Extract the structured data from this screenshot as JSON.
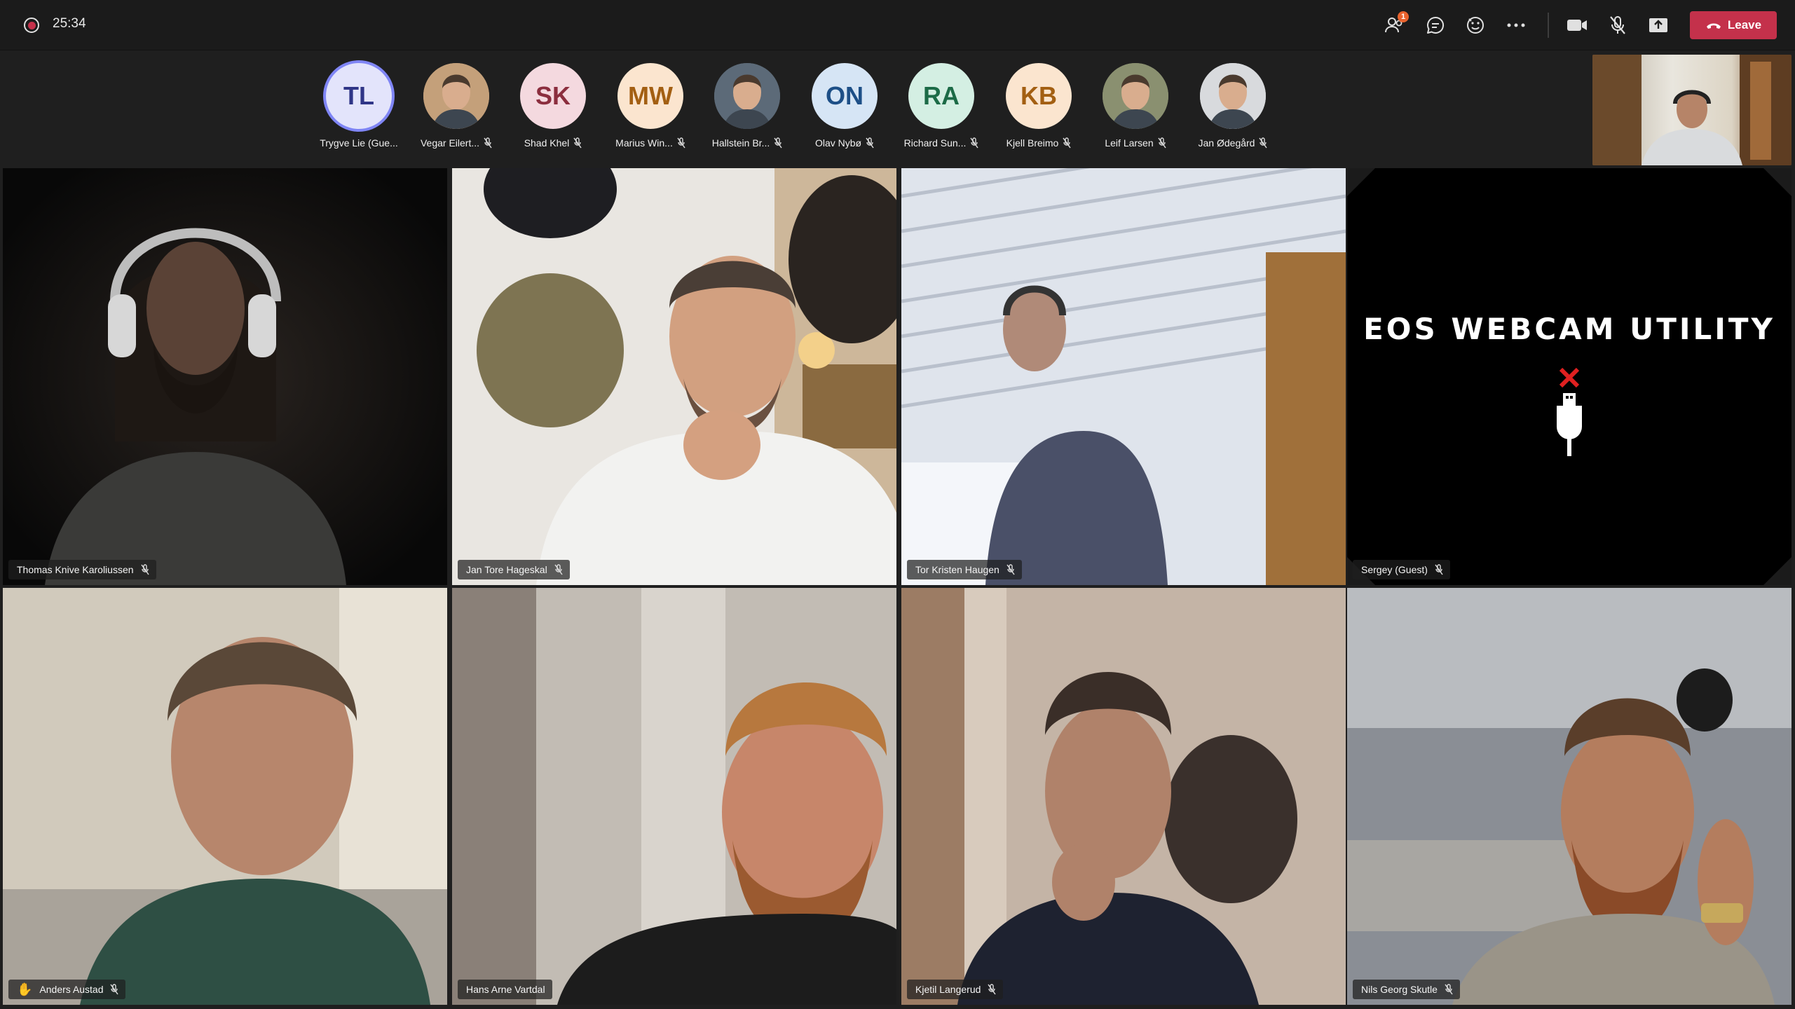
{
  "meeting": {
    "timer": "25:34",
    "participants_badge": "1",
    "leave_label": "Leave"
  },
  "icons": {
    "record": "recording-indicator-icon",
    "people": "people-icon",
    "chat": "chat-icon",
    "reactions": "reactions-icon",
    "more": "more-actions-icon",
    "camera": "camera-icon",
    "mic": "mic-muted-icon",
    "share": "share-screen-icon",
    "hangup": "hang-up-icon"
  },
  "participants": [
    {
      "initials": "TL",
      "name": "Trygve Lie (Gue...",
      "bg": "#e3e4fb",
      "fg": "#2f3587",
      "muted": false,
      "photo": false
    },
    {
      "initials": "",
      "name": "Vegar Eilert...",
      "bg": "#c4a07a",
      "fg": "#ffffff",
      "muted": true,
      "photo": true
    },
    {
      "initials": "SK",
      "name": "Shad Khel",
      "bg": "#f4d9df",
      "fg": "#8b2e3e",
      "muted": true,
      "photo": false
    },
    {
      "initials": "MW",
      "name": "Marius Win...",
      "bg": "#fbe5cf",
      "fg": "#a35f12",
      "muted": true,
      "photo": false
    },
    {
      "initials": "",
      "name": "Hallstein Br...",
      "bg": "#5c6a78",
      "fg": "#ffffff",
      "muted": true,
      "photo": true
    },
    {
      "initials": "ON",
      "name": "Olav Nybø",
      "bg": "#d6e5f5",
      "fg": "#1d4f87",
      "muted": true,
      "photo": false
    },
    {
      "initials": "RA",
      "name": "Richard Sun...",
      "bg": "#d4efe3",
      "fg": "#1c6b47",
      "muted": true,
      "photo": false
    },
    {
      "initials": "KB",
      "name": "Kjell Breimo",
      "bg": "#fbe5cf",
      "fg": "#a35f12",
      "muted": true,
      "photo": false
    },
    {
      "initials": "",
      "name": "Leif Larsen",
      "bg": "#8a9070",
      "fg": "#ffffff",
      "muted": true,
      "photo": true
    },
    {
      "initials": "",
      "name": "Jan Ødegård",
      "bg": "#d8dadd",
      "fg": "#ffffff",
      "muted": true,
      "photo": true
    }
  ],
  "tiles": [
    {
      "name": "Thomas Knive Karoliussen",
      "raised_hand": false
    },
    {
      "name": "Jan Tore Hageskal",
      "raised_hand": false
    },
    {
      "name": "Tor Kristen Haugen",
      "raised_hand": false
    },
    {
      "name": "Sergey (Guest)",
      "raised_hand": false,
      "placeholder_title": "EOS WEBCAM UTILITY"
    },
    {
      "name": "Anders Austad",
      "raised_hand": true
    },
    {
      "name": "Hans Arne Vartdal",
      "raised_hand": false
    },
    {
      "name": "Kjetil Langerud",
      "raised_hand": false
    },
    {
      "name": "Nils Georg Skutle",
      "raised_hand": false
    }
  ]
}
